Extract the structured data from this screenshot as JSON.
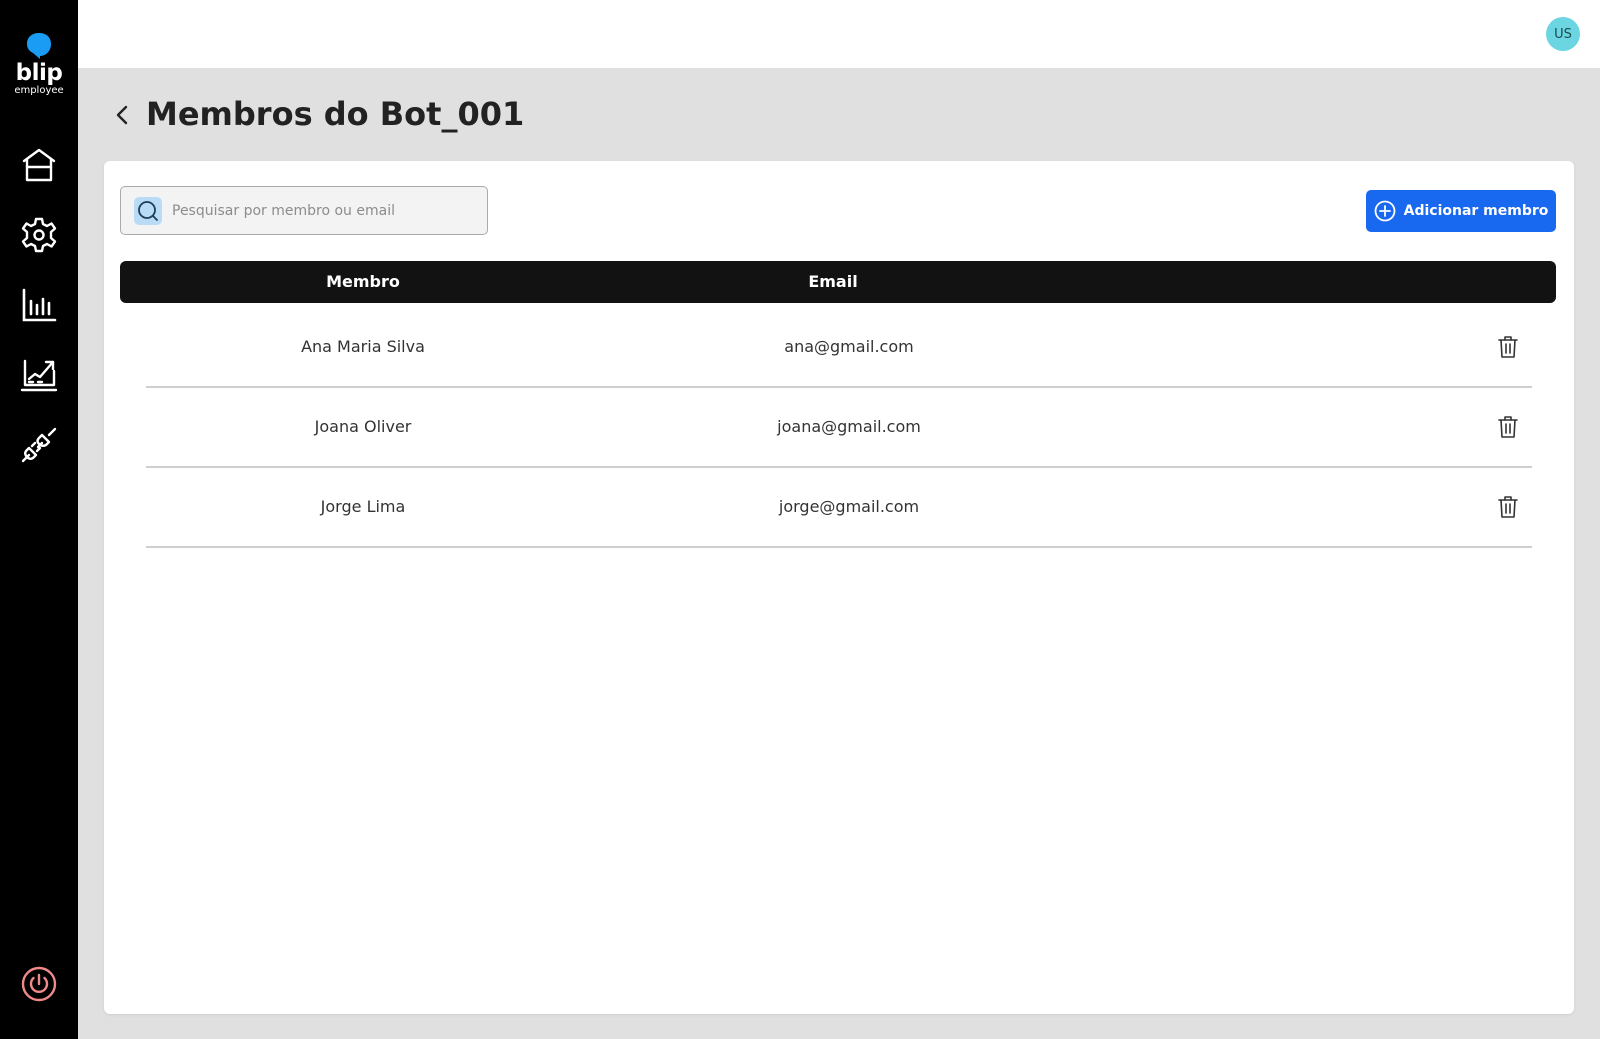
{
  "brand": {
    "name": "blip",
    "subtitle": "employee",
    "color": "#1a9cf5"
  },
  "sidebar": {
    "items": [
      {
        "icon": "home-icon"
      },
      {
        "icon": "gear-icon"
      },
      {
        "icon": "bar-chart-icon"
      },
      {
        "icon": "growth-chart-icon"
      },
      {
        "icon": "plug-icon"
      }
    ],
    "logout_icon": "power-icon",
    "logout_color": "#f08a8a"
  },
  "header": {
    "avatar_initials": "US",
    "avatar_color": "#6bd5e1"
  },
  "page": {
    "title": "Membros do Bot_001"
  },
  "search": {
    "placeholder": "Pesquisar por membro ou email",
    "value": ""
  },
  "actions": {
    "add_label": "Adicionar membro",
    "accent": "#1968f0"
  },
  "table": {
    "columns": [
      "Membro",
      "Email"
    ],
    "rows": [
      {
        "member": "Ana Maria Silva",
        "email": "ana@gmail.com"
      },
      {
        "member": "Joana Oliver",
        "email": "joana@gmail.com"
      },
      {
        "member": "Jorge Lima",
        "email": "jorge@gmail.com"
      }
    ]
  }
}
